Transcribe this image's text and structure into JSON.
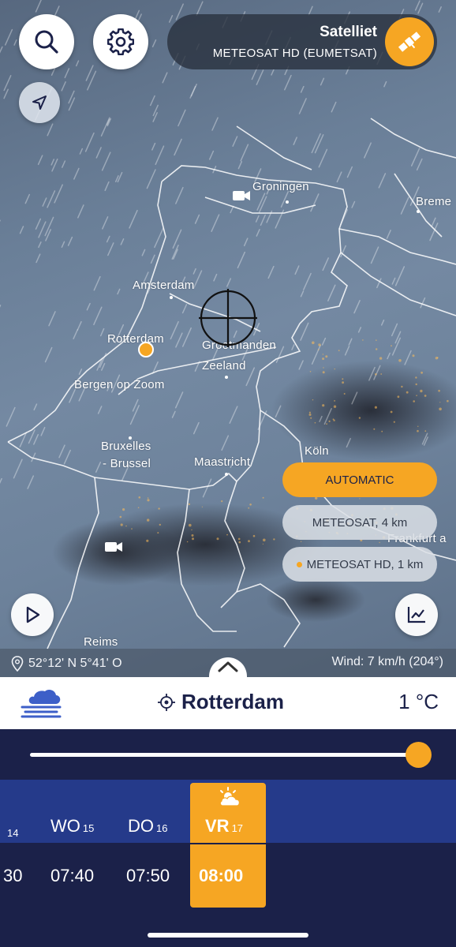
{
  "layer": {
    "title": "Satelliet",
    "subtitle": "METEOSAT HD (EUMETSAT)"
  },
  "map": {
    "cities": [
      {
        "name": "Groningen"
      },
      {
        "name": "Breme"
      },
      {
        "name": "Amsterdam"
      },
      {
        "name": "Rotterdam"
      },
      {
        "name": "Grootmanden"
      },
      {
        "name": "Zeeland"
      },
      {
        "name": "Bergen op Zoom"
      },
      {
        "name": "Bruxelles"
      },
      {
        "name": "- Brussel"
      },
      {
        "name": "Maastricht"
      },
      {
        "name": "Köln"
      },
      {
        "name": "Frankfurt a"
      },
      {
        "name": "Reims"
      }
    ],
    "source_options": {
      "automatic": "AUTOMATIC",
      "meteosat_4km": "METEOSAT, 4 km",
      "meteosat_hd": "METEOSAT HD, 1 km"
    },
    "coordinates": "52°12' N 5°41' O",
    "wind": "Wind: 7 km/h (204°)"
  },
  "location": {
    "name": "Rotterdam",
    "temperature": "1 °C"
  },
  "timeline": {
    "progress": 1.0,
    "days": [
      {
        "name": "",
        "date": "14"
      },
      {
        "name": "WO",
        "date": "15"
      },
      {
        "name": "DO",
        "date": "16"
      },
      {
        "name": "VR",
        "date": "17"
      }
    ],
    "times": [
      "30",
      "07:40",
      "07:50",
      "08:00"
    ],
    "selected_index": 3
  },
  "colors": {
    "accent": "#f6a623",
    "navy": "#1b2149",
    "blue_band": "#253a8a"
  }
}
